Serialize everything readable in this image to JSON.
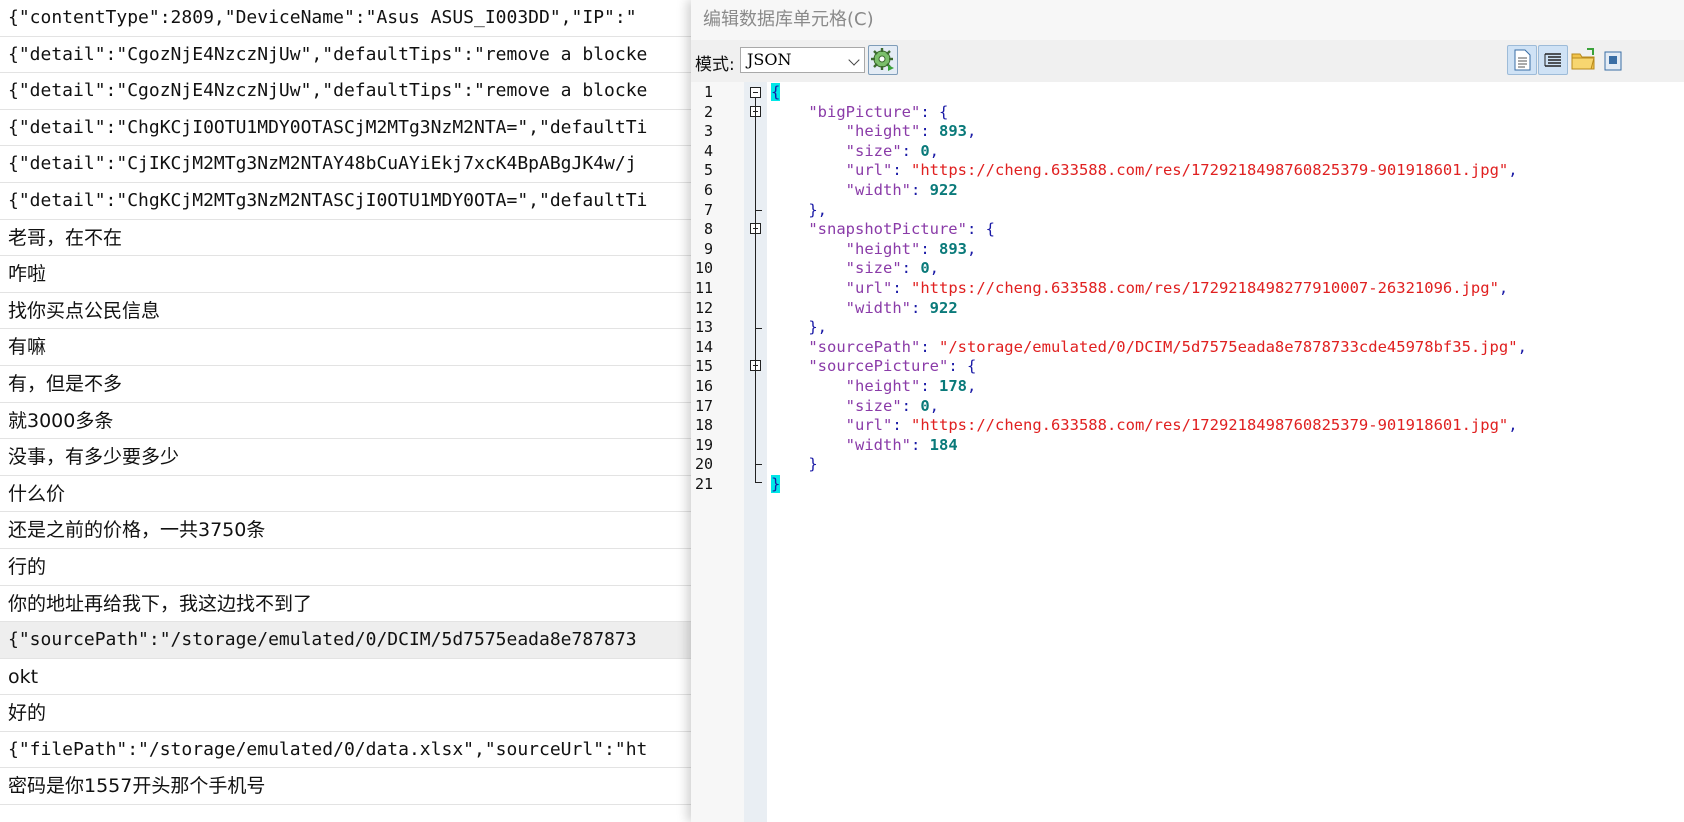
{
  "rows": [
    {
      "text": "{\"contentType\":2809,\"DeviceName\":\"Asus ASUS_I003DD\",\"IP\":\"",
      "mono": true
    },
    {
      "text": "{\"detail\":\"CgozNjE4NzczNjUw\",\"defaultTips\":\"remove a blocke",
      "mono": true
    },
    {
      "text": "{\"detail\":\"CgozNjE4NzczNjUw\",\"defaultTips\":\"remove a blocke",
      "mono": true
    },
    {
      "text": "{\"detail\":\"ChgKCjI0OTU1MDY0OTASCjM2MTg3NzM2NTA=\",\"defaultTi",
      "mono": true
    },
    {
      "text": "{\"detail\":\"CjIKCjM2MTg3NzM2NTAY48bCuAYiEkj7xcK4BpABgJK4w/j",
      "mono": true
    },
    {
      "text": "{\"detail\":\"ChgKCjM2MTg3NzM2NTASCjI0OTU1MDY0OTA=\",\"defaultTi",
      "mono": true
    },
    {
      "text": "老哥，在不在",
      "mono": false
    },
    {
      "text": "咋啦",
      "mono": false
    },
    {
      "text": "找你买点公民信息",
      "mono": false
    },
    {
      "text": "有嘛",
      "mono": false
    },
    {
      "text": "有，但是不多",
      "mono": false
    },
    {
      "text": "就3000多条",
      "mono": false
    },
    {
      "text": "没事，有多少要多少",
      "mono": false
    },
    {
      "text": "什么价",
      "mono": false
    },
    {
      "text": "还是之前的价格，一共3750条",
      "mono": false
    },
    {
      "text": "行的",
      "mono": false
    },
    {
      "text": "你的地址再给我下，我这边找不到了",
      "mono": false
    },
    {
      "text": "{\"sourcePath\":\"/storage/emulated/0/DCIM/5d7575eada8e787873",
      "mono": true,
      "selected": true
    },
    {
      "text": "okt",
      "mono": false
    },
    {
      "text": "好的",
      "mono": false
    },
    {
      "text": "{\"filePath\":\"/storage/emulated/0/data.xlsx\",\"sourceUrl\":\"ht",
      "mono": true
    },
    {
      "text": "密码是你1557开头那个手机号",
      "mono": false
    }
  ],
  "dialog": {
    "title": "编辑数据库单元格(C)",
    "mode_label": "模式:",
    "mode_value": "JSON"
  },
  "editor": {
    "line_numbers": [
      "1",
      "2",
      "3",
      "4",
      "5",
      "6",
      "7",
      "8",
      "9",
      "10",
      "11",
      "12",
      "13",
      "14",
      "15",
      "16",
      "17",
      "18",
      "19",
      "20",
      "21"
    ],
    "code": {
      "l1_open": "{",
      "l2_key": "\"bigPicture\"",
      "l3_key": "\"height\"",
      "l3_val": "893",
      "l4_key": "\"size\"",
      "l4_val": "0",
      "l5_key": "\"url\"",
      "l5_val": "\"https://cheng.633588.com/res/1729218498760825379-901918601.jpg\"",
      "l6_key": "\"width\"",
      "l6_val": "922",
      "l8_key": "\"snapshotPicture\"",
      "l9_key": "\"height\"",
      "l9_val": "893",
      "l10_key": "\"size\"",
      "l10_val": "0",
      "l11_key": "\"url\"",
      "l11_val": "\"https://cheng.633588.com/res/1729218498277910007-26321096.jpg\"",
      "l12_key": "\"width\"",
      "l12_val": "922",
      "l14_key": "\"sourcePath\"",
      "l14_val": "\"/storage/emulated/0/DCIM/5d7575eada8e7878733cde45978bf35.jpg\"",
      "l15_key": "\"sourcePicture\"",
      "l16_key": "\"height\"",
      "l16_val": "178",
      "l17_key": "\"size\"",
      "l17_val": "0",
      "l18_key": "\"url\"",
      "l18_val": "\"https://cheng.633588.com/res/1729218498760825379-901918601.jpg\"",
      "l19_key": "\"width\"",
      "l19_val": "184",
      "l21_close": "}"
    }
  },
  "icons": {
    "settings": "gear-icon",
    "doc": "document-icon",
    "lines": "list-lines-icon",
    "folder": "folder-icon",
    "extra": "export-icon"
  },
  "colors": {
    "key": "#8a3ba8",
    "punct": "#1a1aa6",
    "number": "#0a7a7a",
    "string": "#e02020",
    "brace_highlight": "#00e7e7"
  }
}
